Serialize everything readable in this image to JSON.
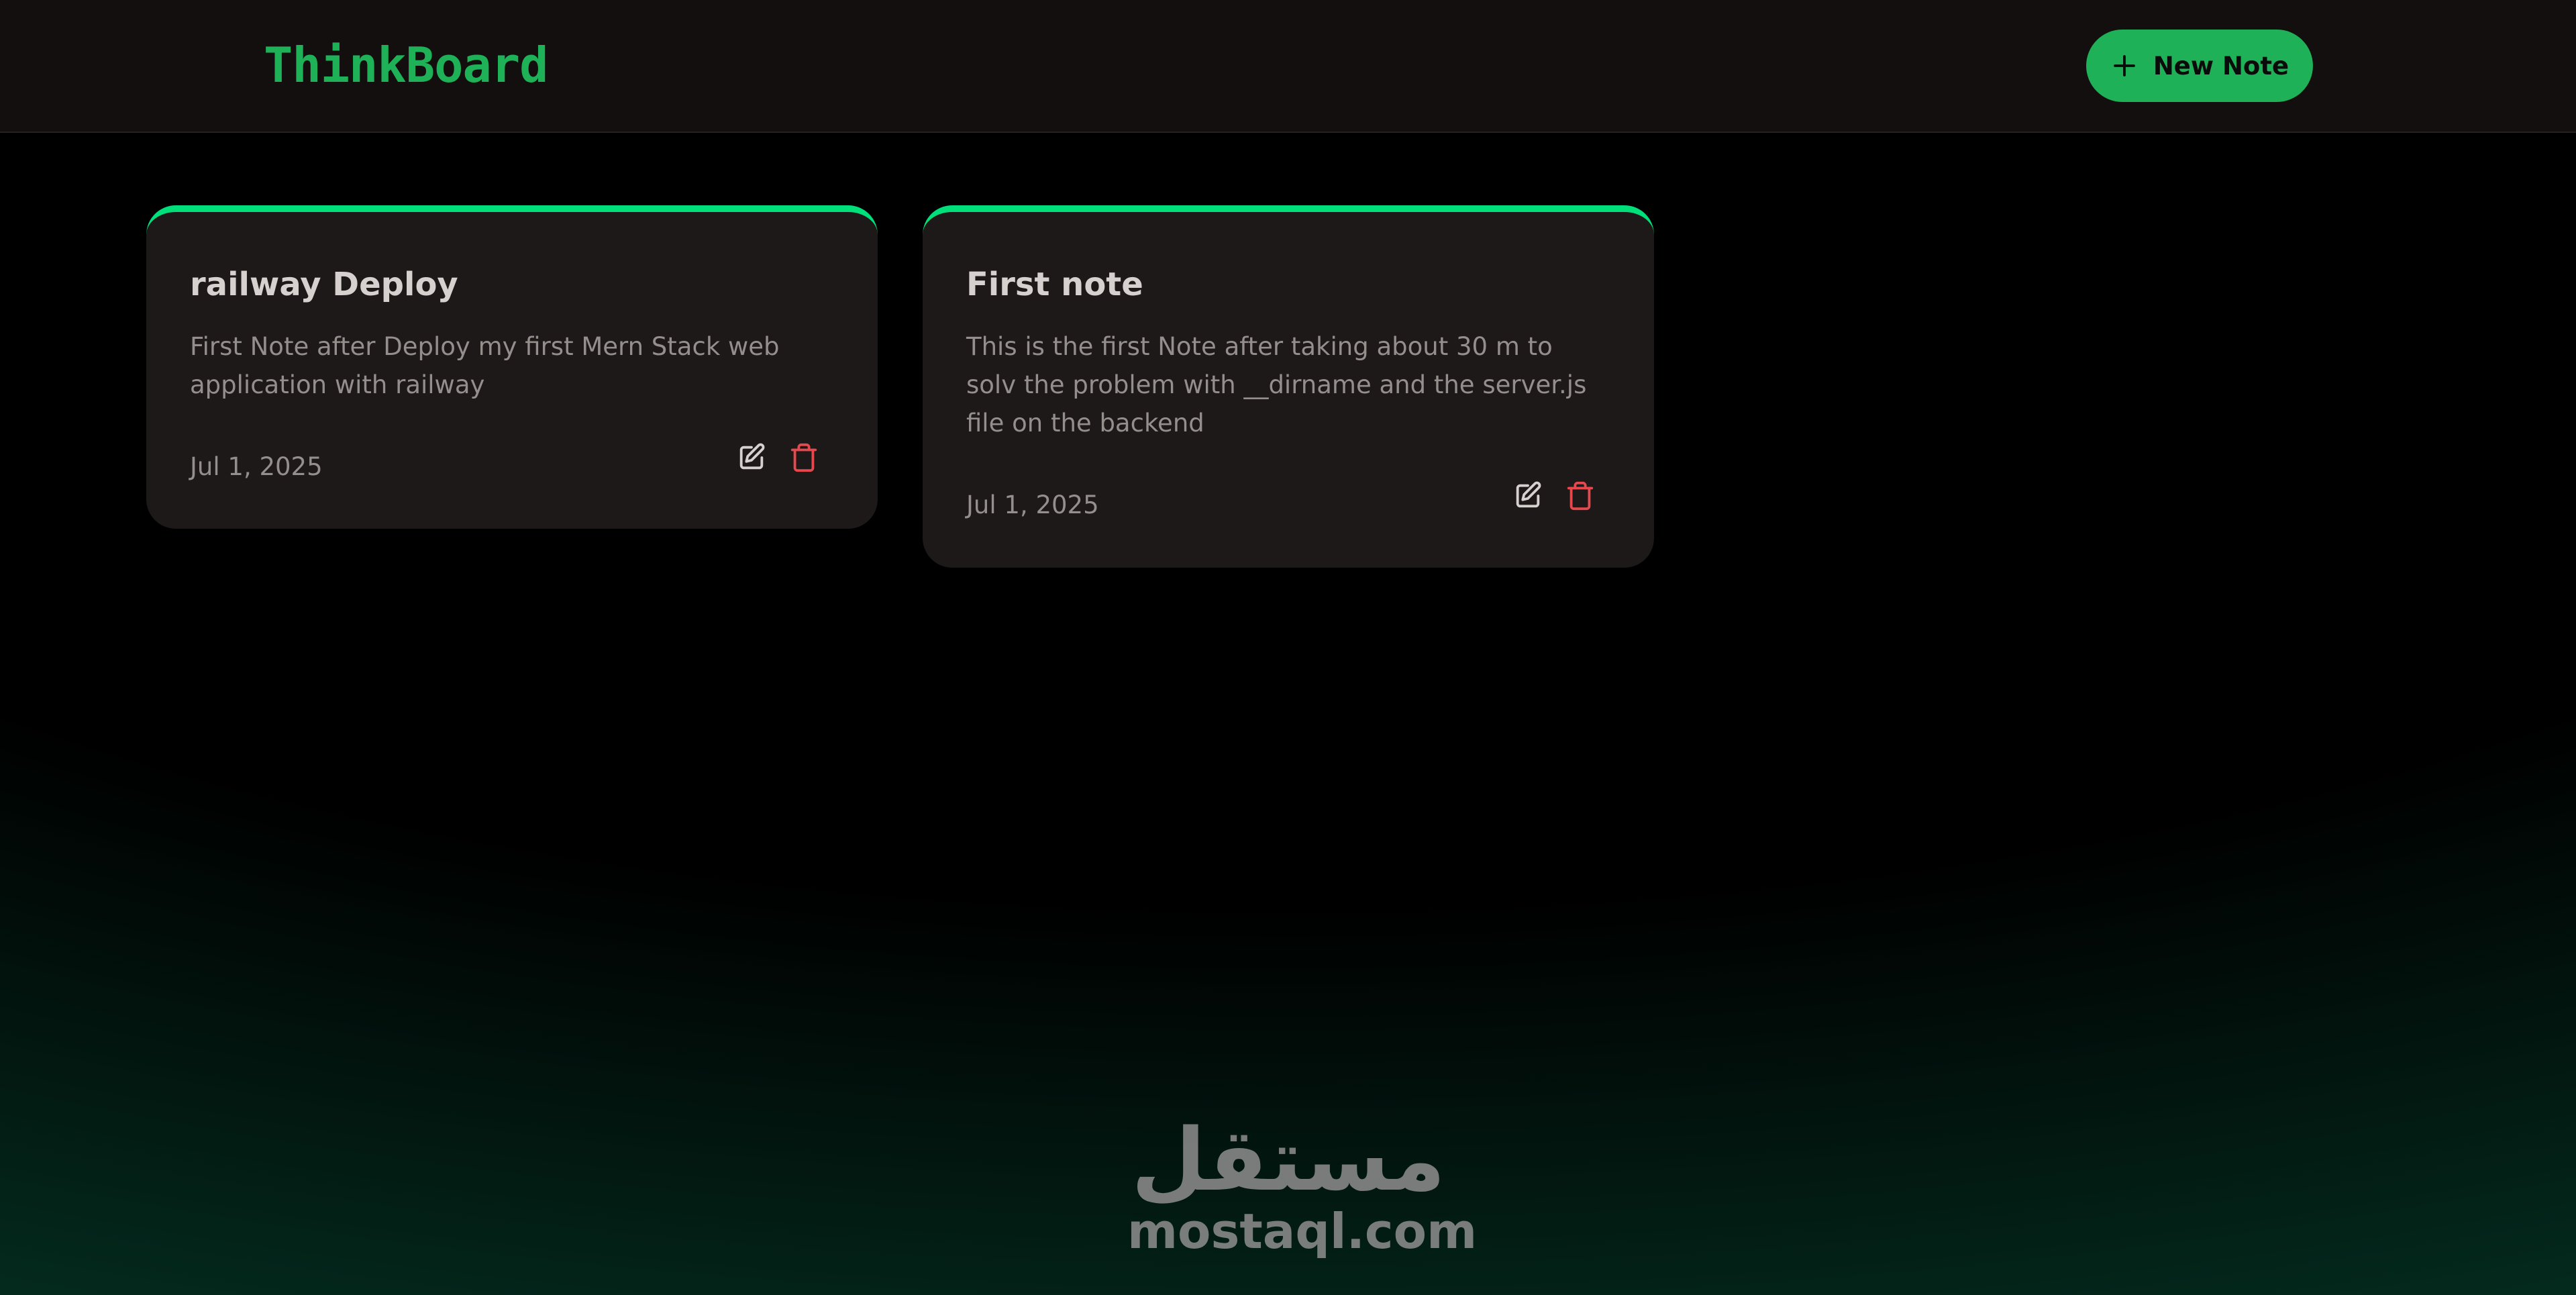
{
  "app": {
    "logo": "ThinkBoard",
    "new_note_label": "New Note",
    "accent_color": "#1fb157"
  },
  "notes": [
    {
      "title": "railway Deploy",
      "content": "First Note after Deploy my first Mern Stack web application with railway",
      "date": "Jul 1, 2025"
    },
    {
      "title": "First note",
      "content": "This is the first Note after taking about 30 m to solv the problem with __dirname and the server.js file on the backend",
      "date": "Jul 1, 2025"
    }
  ],
  "watermark": {
    "arabic": "مستقل",
    "latin": "mostaql.com"
  }
}
